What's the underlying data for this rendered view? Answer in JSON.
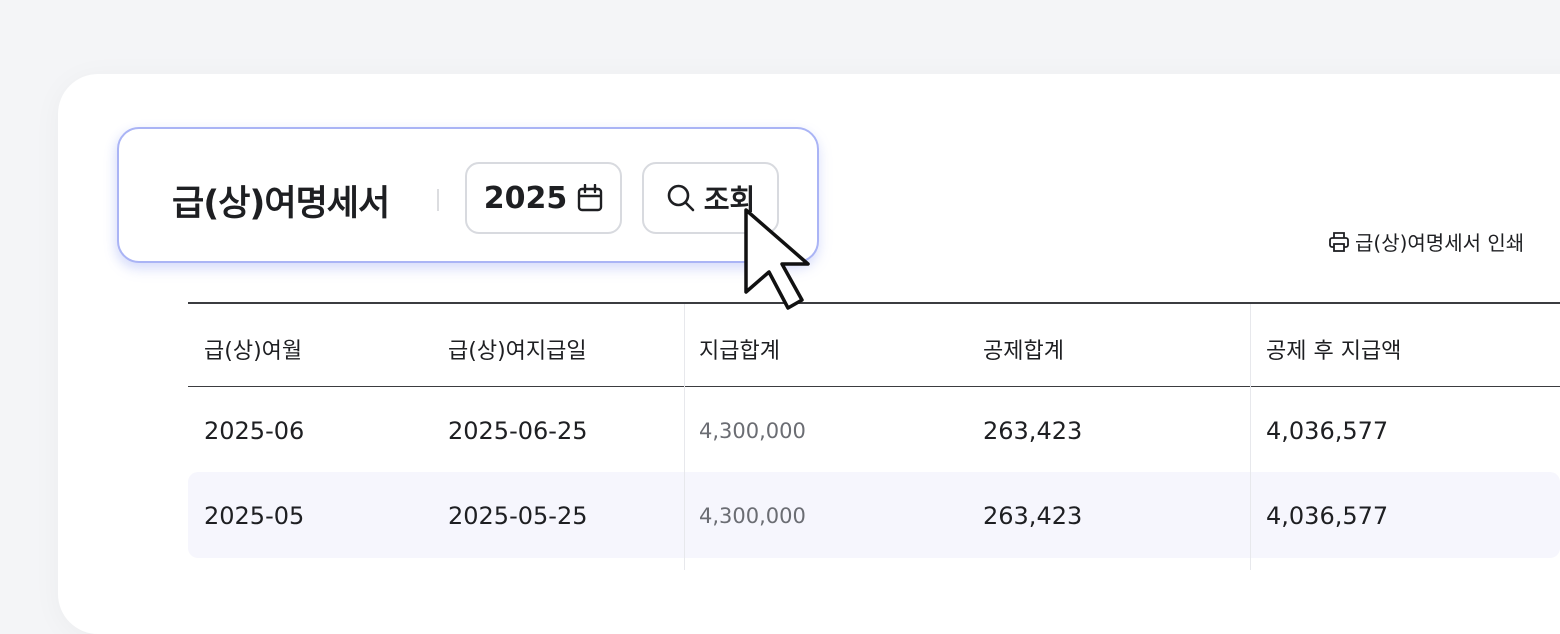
{
  "toolbar": {
    "title": "급(상)여명세서",
    "year_value": "2025",
    "search_label": "조회"
  },
  "actions": {
    "print_label": "급(상)여명세서 인쇄"
  },
  "table": {
    "columns": [
      "급(상)여월",
      "급(상)여지급일",
      "지급합계",
      "공제합계",
      "공제 후 지급액"
    ],
    "rows": [
      [
        "2025-06",
        "2025-06-25",
        "4,300,000",
        "263,423",
        "4,036,577"
      ],
      [
        "2025-05",
        "2025-05-25",
        "4,300,000",
        "263,423",
        "4,036,577"
      ]
    ]
  },
  "colors": {
    "accent_border": "#aab4f5",
    "highlight_row": "#f6f6fd"
  },
  "icons": [
    "calendar-icon",
    "search-icon",
    "printer-icon",
    "mouse-cursor-icon"
  ]
}
